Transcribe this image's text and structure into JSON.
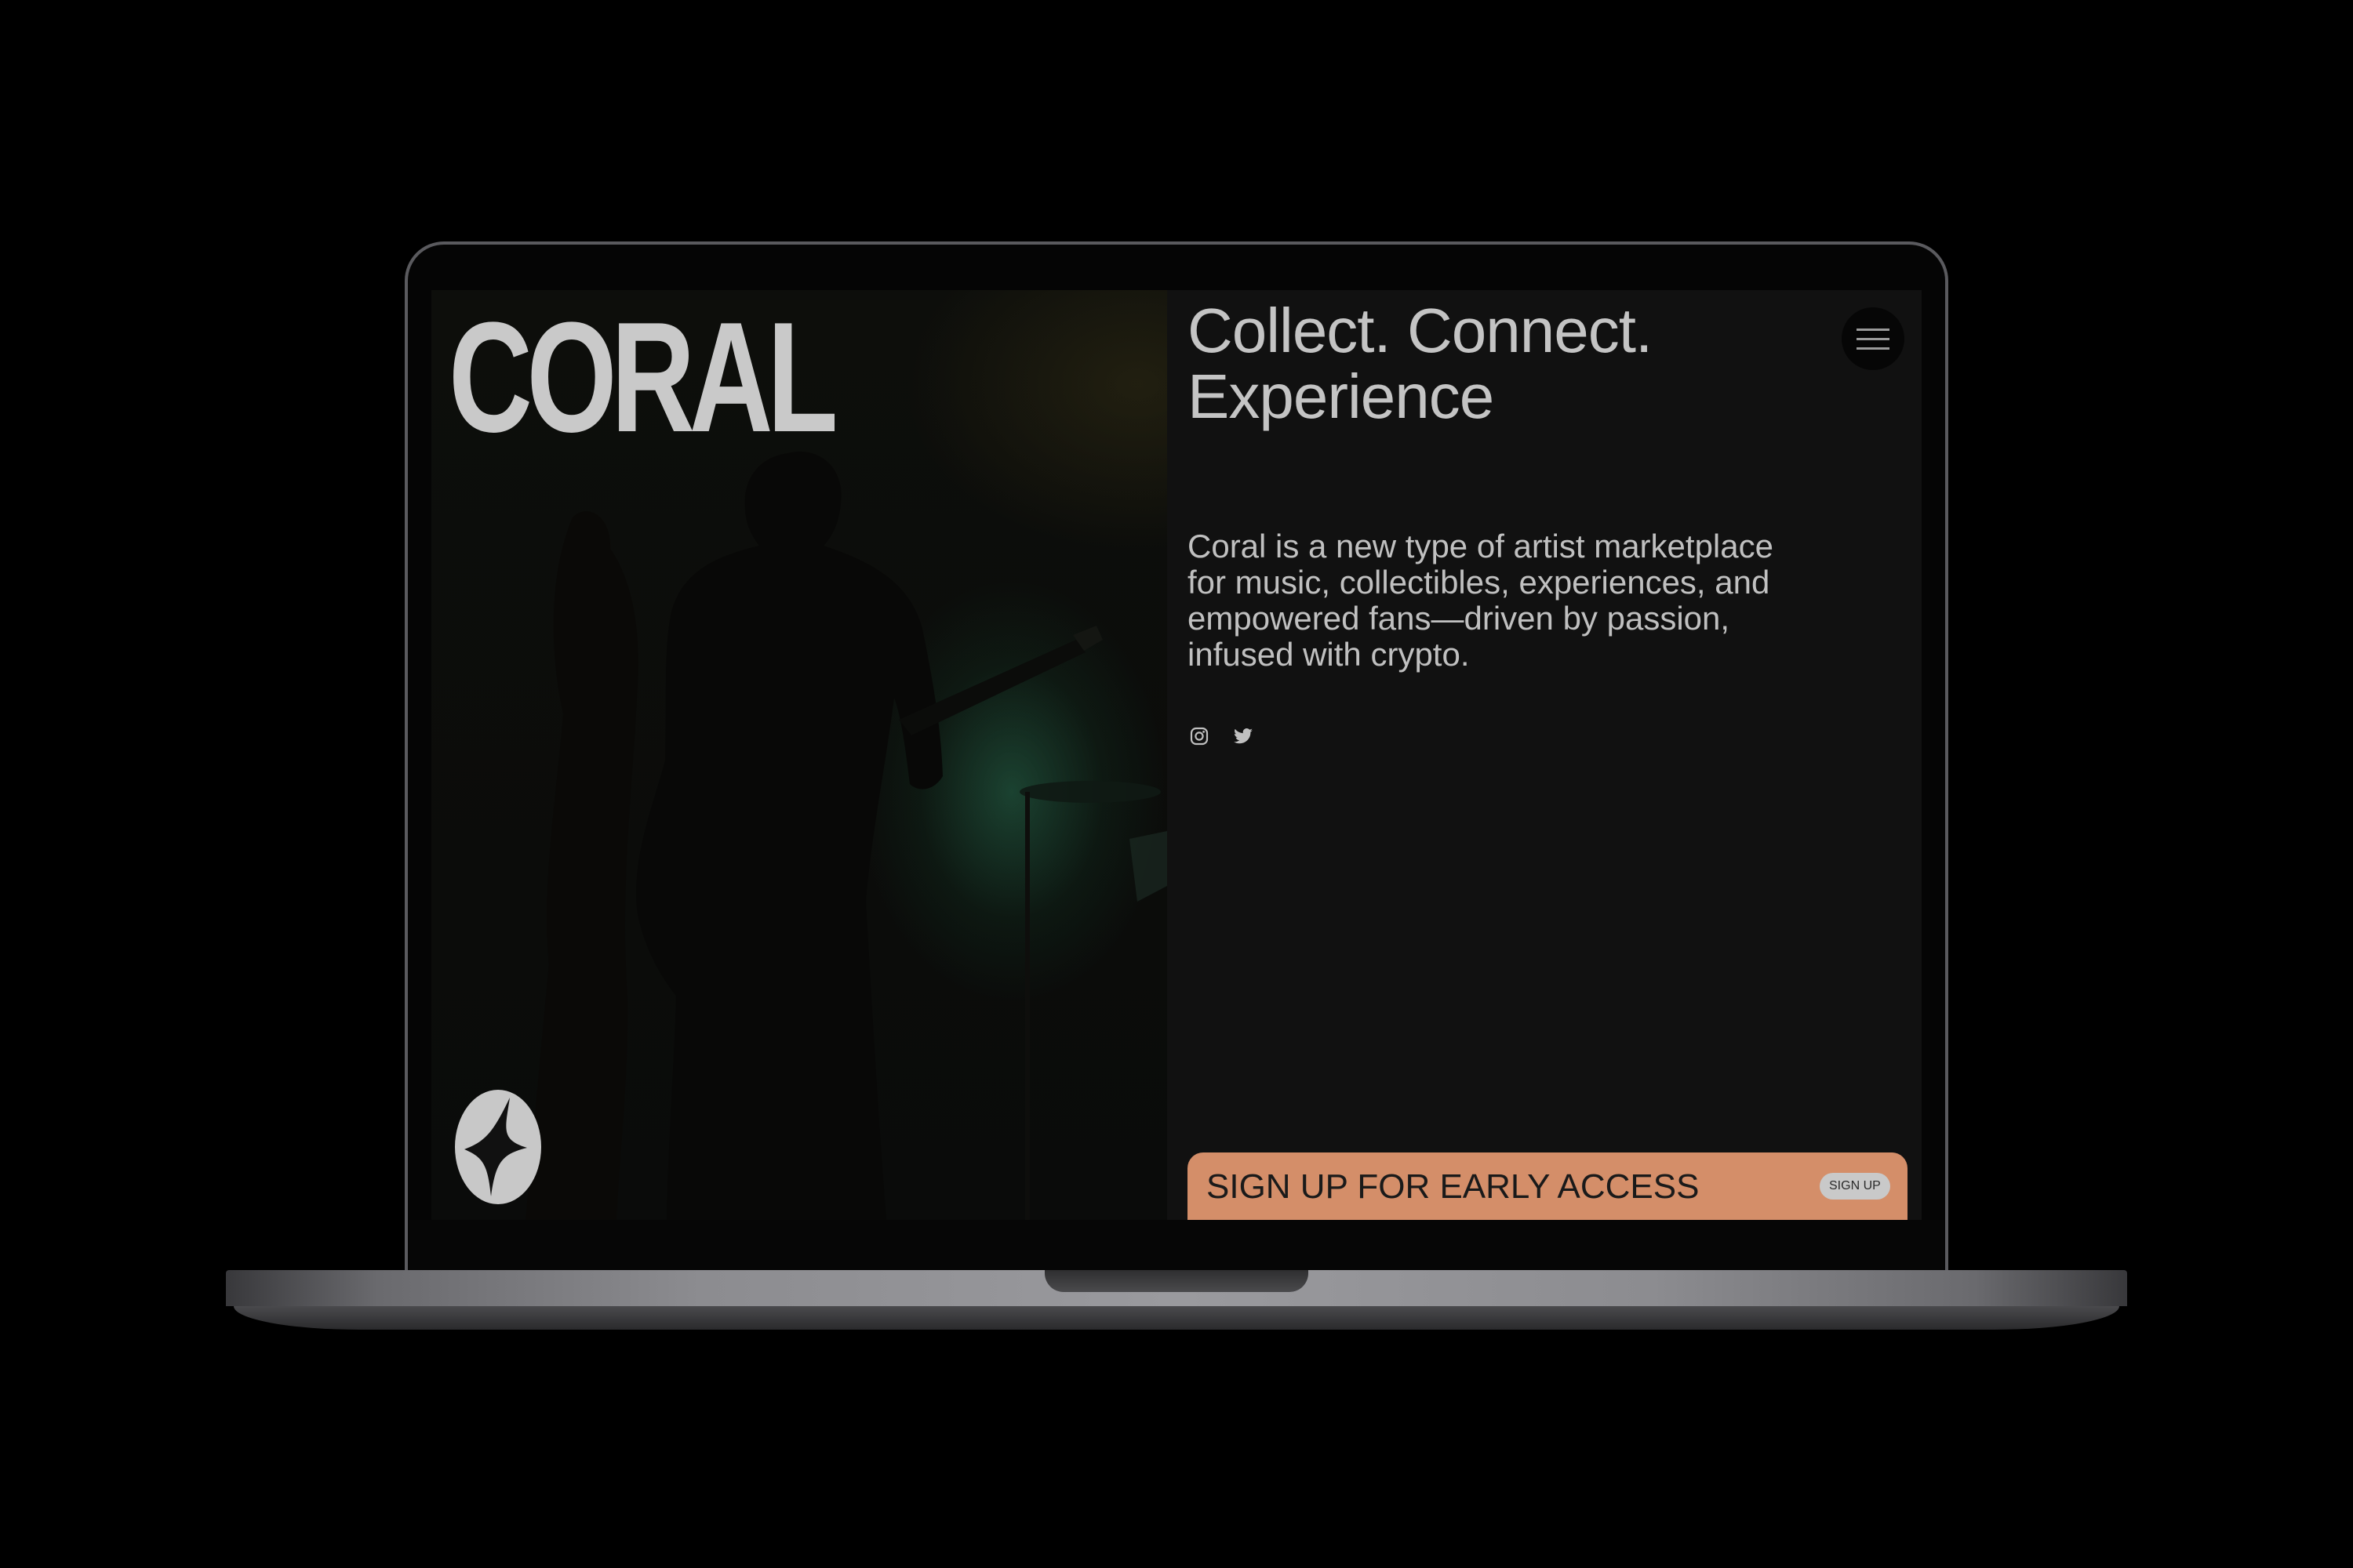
{
  "brand": {
    "wordmark": "CORAL"
  },
  "hero": {
    "headline": "Collect. Connect. Experience",
    "description": "Coral is a new type of artist marketplace for music, collectibles, experiences, and empowered fans—driven by passion, infused with crypto."
  },
  "social": {
    "icons": [
      "instagram-icon",
      "twitter-icon"
    ]
  },
  "menu": {
    "icon": "hamburger-menu-icon"
  },
  "cta": {
    "label": "SIGN UP FOR EARLY ACCESS",
    "button_label": "SIGN UP"
  },
  "colors": {
    "background": "#000000",
    "panel": "#111111",
    "text": "#c4c4c4",
    "cta": "#d48e69"
  }
}
